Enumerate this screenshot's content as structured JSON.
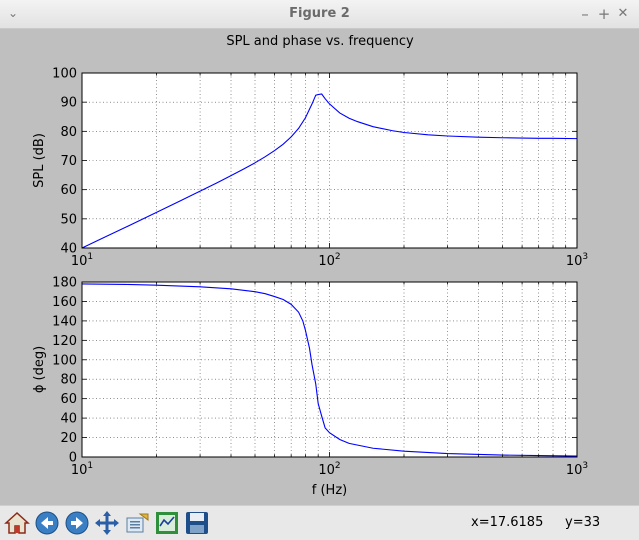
{
  "window": {
    "title": "Figure 2",
    "left_glyph": "⌄",
    "btn_min": "–",
    "btn_max": "+",
    "btn_close": "✕"
  },
  "figure": {
    "suptitle": "SPL and phase vs. frequency"
  },
  "status": {
    "x": "x=17.6185",
    "y": "y=33"
  },
  "toolbar": {
    "tools": [
      "home-icon",
      "back-arrow-icon",
      "forward-arrow-icon",
      "pan-move-icon",
      "zoom-rect-icon",
      "configure-subplots-icon",
      "save-disk-icon"
    ]
  },
  "colors": {
    "line": "#0000ff"
  },
  "chart_data": [
    {
      "type": "line",
      "ylabel": "SPL (dB)",
      "xlabel": "",
      "xscale": "log",
      "xlim": [
        10,
        1000
      ],
      "ylim": [
        40,
        100
      ],
      "xticks": [
        10,
        100,
        1000
      ],
      "xtick_labels": [
        {
          "base": "10",
          "exp": "1"
        },
        {
          "base": "10",
          "exp": "2"
        },
        {
          "base": "10",
          "exp": "3"
        }
      ],
      "yticks": [
        40,
        50,
        60,
        70,
        80,
        90,
        100
      ],
      "ytick_labels": [
        "40",
        "50",
        "60",
        "70",
        "80",
        "90",
        "100"
      ],
      "grid": true,
      "series": [
        {
          "x": [
            10,
            12,
            15,
            20,
            25,
            30,
            35,
            40,
            45,
            50,
            55,
            60,
            65,
            70,
            75,
            80,
            85,
            88,
            90,
            93,
            96,
            100,
            110,
            120,
            130,
            150,
            180,
            200,
            250,
            300,
            400,
            500,
            600,
            700,
            800,
            1000
          ],
          "y": [
            40,
            43.2,
            47.1,
            52.2,
            56.2,
            59.5,
            62.3,
            64.8,
            67.1,
            69.2,
            71.3,
            73.4,
            75.6,
            78.1,
            81.0,
            84.7,
            89.4,
            92.4,
            92.6,
            92.8,
            91.2,
            89.4,
            86.3,
            84.5,
            83.3,
            81.6,
            80.2,
            79.6,
            78.8,
            78.4,
            78.0,
            77.8,
            77.7,
            77.6,
            77.6,
            77.5
          ]
        }
      ]
    },
    {
      "type": "line",
      "ylabel": "ϕ (deg)",
      "xlabel": "f (Hz)",
      "xscale": "log",
      "xlim": [
        10,
        1000
      ],
      "ylim": [
        0,
        180
      ],
      "xticks": [
        10,
        100,
        1000
      ],
      "xtick_labels": [
        {
          "base": "10",
          "exp": "1"
        },
        {
          "base": "10",
          "exp": "2"
        },
        {
          "base": "10",
          "exp": "3"
        }
      ],
      "yticks": [
        0,
        20,
        40,
        60,
        80,
        100,
        120,
        140,
        160,
        180
      ],
      "ytick_labels": [
        "0",
        "20",
        "40",
        "60",
        "80",
        "100",
        "120",
        "140",
        "160",
        "180"
      ],
      "grid": true,
      "series": [
        {
          "x": [
            10,
            15,
            20,
            30,
            40,
            50,
            55,
            60,
            65,
            70,
            75,
            78,
            80,
            83,
            85,
            88,
            90,
            93,
            96,
            100,
            110,
            120,
            150,
            200,
            300,
            500,
            700,
            1000
          ],
          "y": [
            178,
            177.5,
            176.7,
            175,
            173,
            170,
            168,
            165,
            162,
            157,
            149,
            140,
            130,
            112,
            95,
            75,
            55,
            42,
            30,
            25,
            18,
            14,
            9,
            6,
            3.5,
            2,
            1.5,
            1
          ]
        }
      ]
    }
  ]
}
